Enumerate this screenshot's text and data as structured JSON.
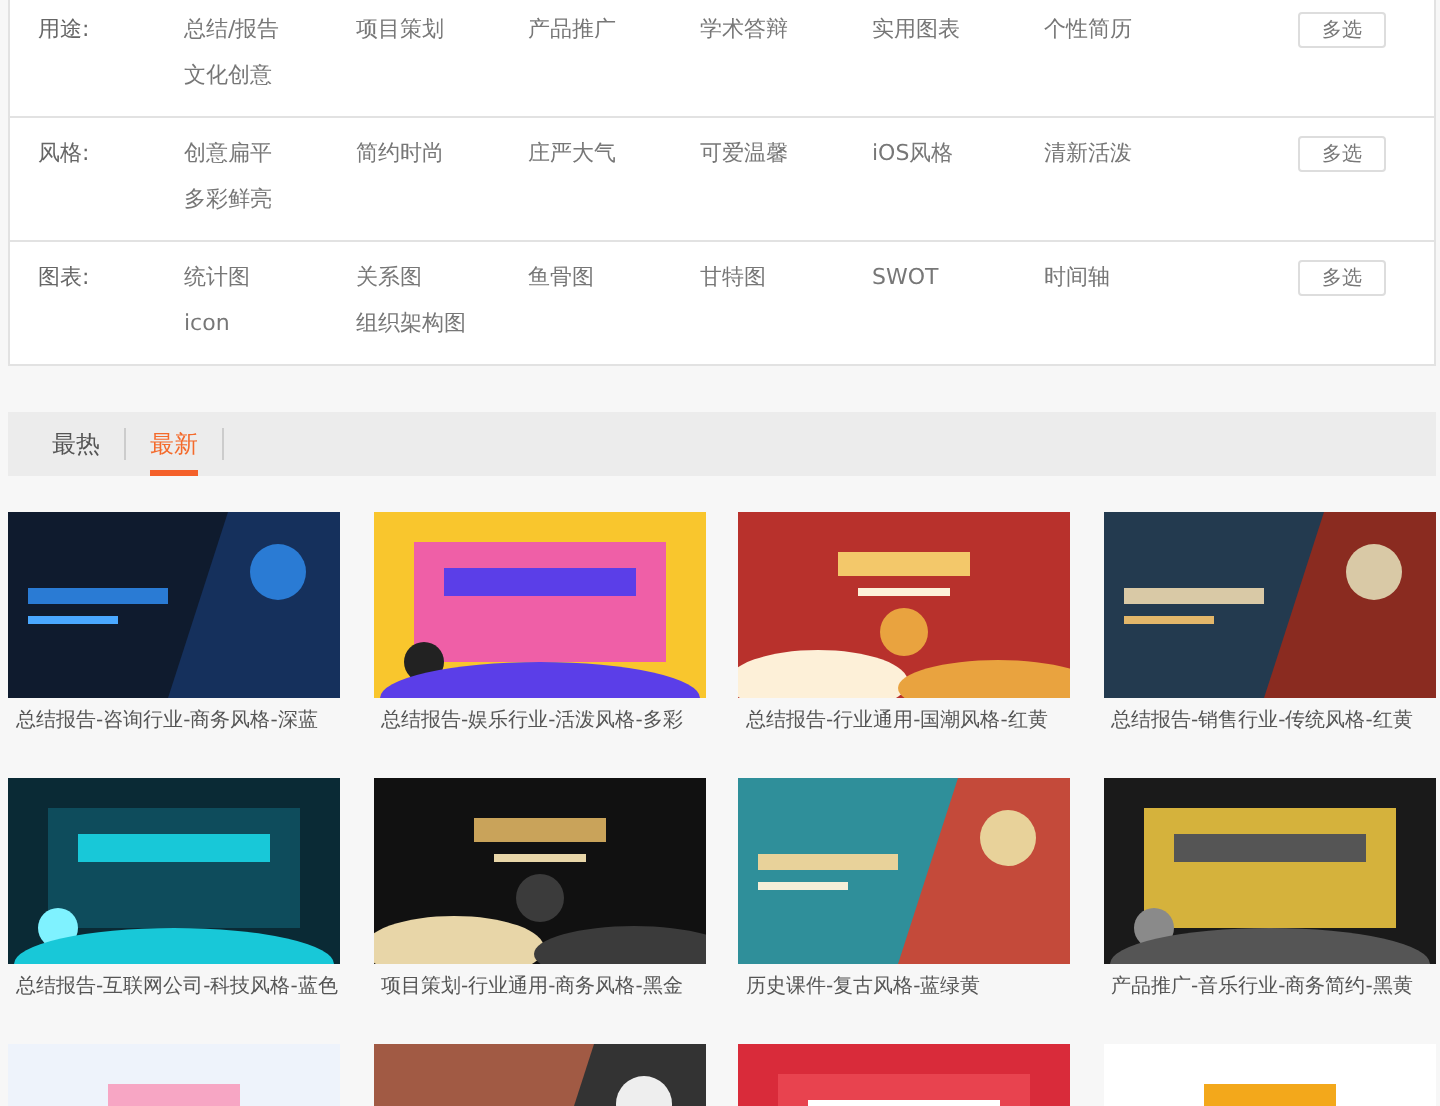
{
  "filters": [
    {
      "label": "用途:",
      "options": [
        "总结/报告",
        "项目策划",
        "产品推广",
        "学术答辩",
        "实用图表",
        "个性简历",
        "文化创意"
      ],
      "button": "多选"
    },
    {
      "label": "风格:",
      "options": [
        "创意扁平",
        "简约时尚",
        "庄严大气",
        "可爱温馨",
        "iOS风格",
        "清新活泼",
        "多彩鲜亮"
      ],
      "button": "多选"
    },
    {
      "label": "图表:",
      "options": [
        "统计图",
        "关系图",
        "鱼骨图",
        "甘特图",
        "SWOT",
        "时间轴",
        "icon",
        "组织架构图"
      ],
      "button": "多选"
    }
  ],
  "sort_tabs": [
    {
      "label": "最热",
      "selected": false
    },
    {
      "label": "最新",
      "selected": true
    }
  ],
  "templates": [
    {
      "kind": "picture",
      "caption": "总结报告-咨询行业-商务风格-深蓝"
    },
    {
      "kind": "picture",
      "caption": "总结报告-娱乐行业-活泼风格-多彩"
    },
    {
      "kind": "picture",
      "caption": "总结报告-行业通用-国潮风格-红黄"
    },
    {
      "kind": "picture",
      "caption": "总结报告-销售行业-传统风格-红黄"
    },
    {
      "kind": "picture",
      "caption": "总结报告-互联网公司-科技风格-蓝色"
    },
    {
      "kind": "picture",
      "caption": "项目策划-行业通用-商务风格-黑金"
    },
    {
      "kind": "picture",
      "caption": "历史课件-复古风格-蓝绿黄"
    },
    {
      "kind": "picture",
      "caption": "产品推广-音乐行业-商务简约-黑黄"
    },
    {
      "kind": "picture"
    },
    {
      "kind": "picture"
    },
    {
      "kind": "picture"
    },
    {
      "kind": "picture"
    }
  ]
}
